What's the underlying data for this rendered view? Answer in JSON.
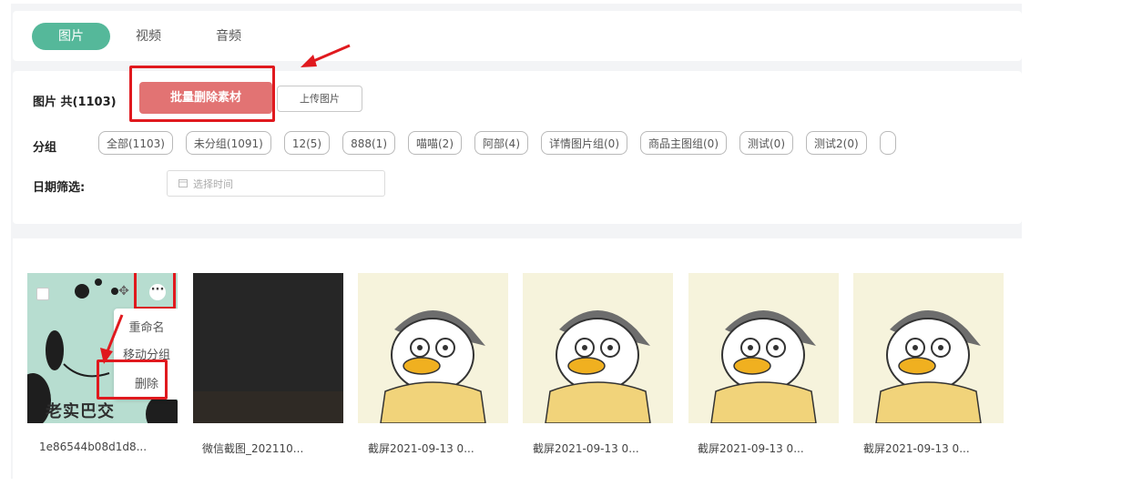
{
  "tabs": [
    {
      "label": "图片",
      "active": true
    },
    {
      "label": "视频",
      "active": false
    },
    {
      "label": "音频",
      "active": false
    }
  ],
  "toolbar": {
    "count_label": "图片 共(1103)",
    "batch_delete_label": "批量删除素材",
    "upload_label": "上传图片"
  },
  "groups": {
    "label": "分组",
    "items": [
      "全部(1103)",
      "未分组(1091)",
      "12(5)",
      "888(1)",
      "喵喵(2)",
      "阿部(4)",
      "详情图片组(0)",
      "商品主图组(0)",
      "测试(0)",
      "测试2(0)",
      ""
    ]
  },
  "date_filter": {
    "label": "日期筛选:",
    "placeholder": "选择时间"
  },
  "gallery": {
    "items": [
      {
        "caption": "1e86544b08d1d8...",
        "image": "panda-meme",
        "overlay_text": "老实巴交"
      },
      {
        "caption": "微信截图_202110...",
        "image": "dark-photo"
      },
      {
        "caption": "截屏2021-09-13 0...",
        "image": "duck-cartoon"
      },
      {
        "caption": "截屏2021-09-13 0...",
        "image": "duck-cartoon"
      },
      {
        "caption": "截屏2021-09-13 0...",
        "image": "duck-cartoon"
      },
      {
        "caption": "截屏2021-09-13 0...",
        "image": "duck-cartoon"
      }
    ],
    "context_menu": [
      "重命名",
      "移动分组",
      "删除"
    ]
  },
  "colors": {
    "accent": "#55b89a",
    "danger_button": "#e27373",
    "highlight_box": "#e0191e"
  }
}
